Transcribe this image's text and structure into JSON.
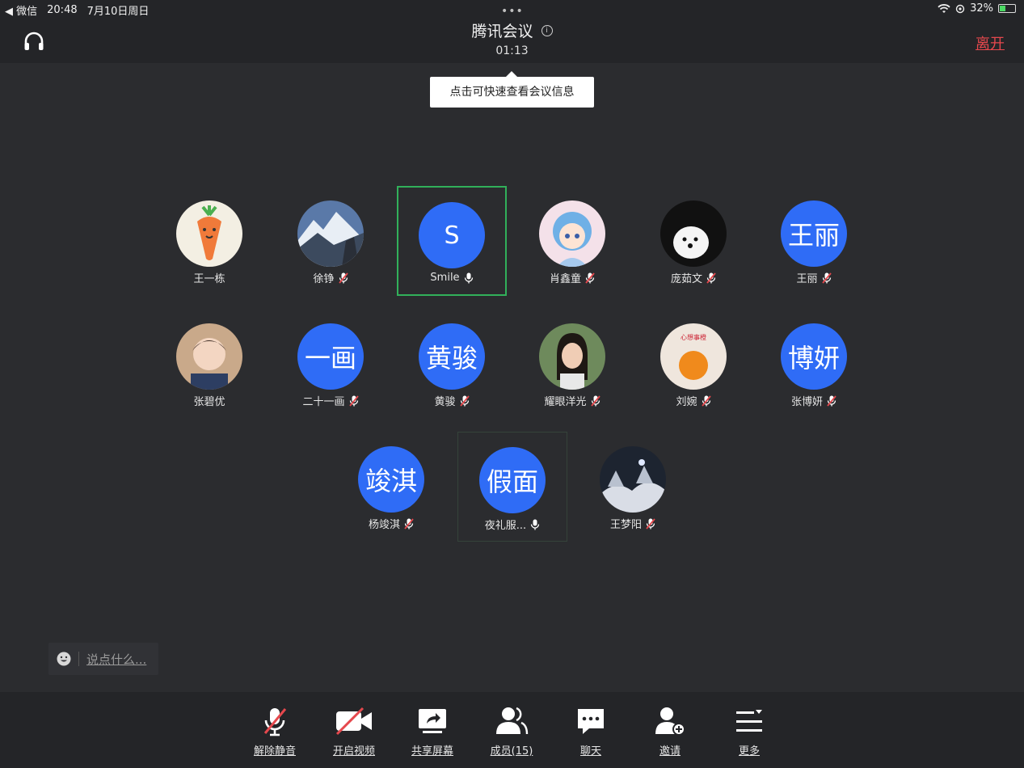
{
  "status_bar": {
    "back_app": "◀ 微信",
    "time": "20:48",
    "date": "7月10日周日",
    "battery": "32%"
  },
  "header": {
    "title": "腾讯会议",
    "info_symbol": "i",
    "timer": "01:13",
    "leave_label": "离开"
  },
  "tooltip": "点击可快速查看会议信息",
  "participants": [
    {
      "name": "王一栋",
      "avatar_text": "",
      "photo": "carrot-avatar",
      "mic": "none"
    },
    {
      "name": "徐铮",
      "avatar_text": "",
      "photo": "mountain-avatar",
      "mic": "muted"
    },
    {
      "name": "Smile",
      "avatar_text": "S",
      "photo": "",
      "mic": "on"
    },
    {
      "name": "肖鑫童",
      "avatar_text": "",
      "photo": "anime-girl-avatar",
      "mic": "muted"
    },
    {
      "name": "庞茹文",
      "avatar_text": "",
      "photo": "dog-avatar",
      "mic": "muted"
    },
    {
      "name": "王丽",
      "avatar_text": "王丽",
      "photo": "",
      "mic": "muted"
    },
    {
      "name": "张碧优",
      "avatar_text": "",
      "photo": "child-avatar",
      "mic": "none"
    },
    {
      "name": "二十一画",
      "avatar_text": "一画",
      "photo": "",
      "mic": "muted"
    },
    {
      "name": "黄骏",
      "avatar_text": "黄骏",
      "photo": "",
      "mic": "muted"
    },
    {
      "name": "耀眼洋光",
      "avatar_text": "",
      "photo": "woman-avatar",
      "mic": "muted"
    },
    {
      "name": "刘婉",
      "avatar_text": "",
      "photo": "orange-avatar",
      "mic": "muted"
    },
    {
      "name": "张博妍",
      "avatar_text": "博妍",
      "photo": "",
      "mic": "muted"
    },
    {
      "name": "杨竣淇",
      "avatar_text": "竣淇",
      "photo": "",
      "mic": "muted"
    },
    {
      "name": "夜礼服...",
      "avatar_text": "假面",
      "photo": "",
      "mic": "on"
    },
    {
      "name": "王梦阳",
      "avatar_text": "",
      "photo": "snow-tree-avatar",
      "mic": "muted"
    }
  ],
  "chat": {
    "placeholder": "说点什么..."
  },
  "toolbar": {
    "unmute": "解除静音",
    "video": "开启视频",
    "share": "共享屏幕",
    "members": "成员(15)",
    "chat": "聊天",
    "invite": "邀请",
    "more": "更多"
  },
  "colors": {
    "background": "#2b2c2f",
    "bar": "#242528",
    "accent_blue": "#2f6cf6",
    "active_green": "#31b05a",
    "muted_red": "#e5484d"
  }
}
